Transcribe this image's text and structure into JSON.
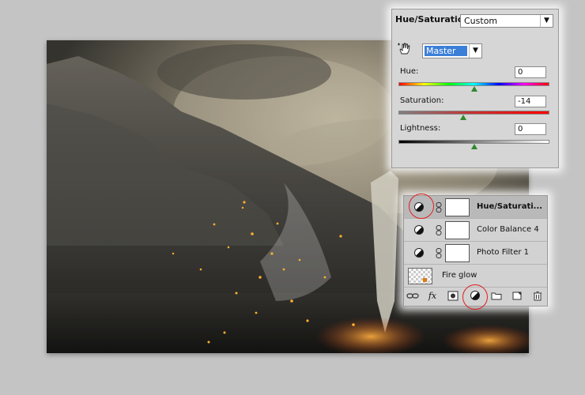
{
  "adjustment_panel": {
    "title": "Hue/Saturation",
    "preset": "Custom",
    "channel": "Master",
    "hue": {
      "label": "Hue:",
      "value": "0",
      "fraction": 0.5
    },
    "saturation": {
      "label": "Saturation:",
      "value": "-14",
      "fraction": 0.43
    },
    "lightness": {
      "label": "Lightness:",
      "value": "0",
      "fraction": 0.5
    }
  },
  "layers_panel": {
    "layers": [
      {
        "name": "Hue/Saturati...",
        "type": "adjustment",
        "selected": true
      },
      {
        "name": "Color Balance 4",
        "type": "adjustment",
        "selected": false
      },
      {
        "name": "Photo Filter 1",
        "type": "adjustment",
        "selected": false
      },
      {
        "name": "Fire glow",
        "type": "pixel",
        "selected": false
      }
    ],
    "toolbar": {
      "link": "link-icon",
      "fx": "fx",
      "mask": "add-mask-icon",
      "adjustment": "new-adjustment-layer-icon",
      "group": "folder-icon",
      "new_layer": "new-layer-icon",
      "delete": "trash-icon"
    }
  },
  "colors": {
    "selection": "#3c7fd8",
    "highlight": "#e02020",
    "thumb": "#2f8a2f"
  }
}
